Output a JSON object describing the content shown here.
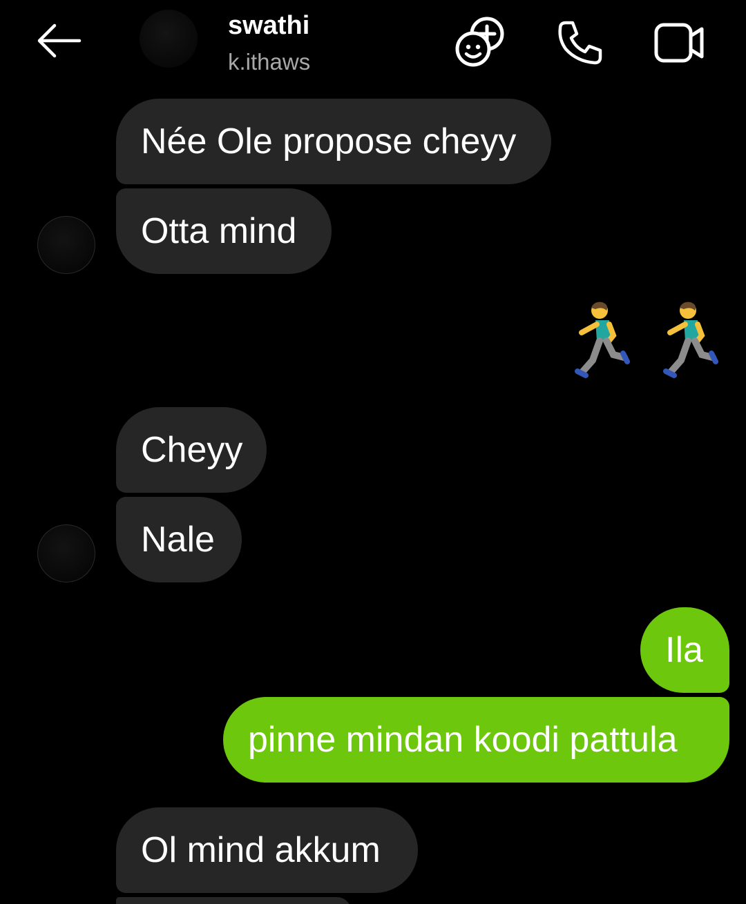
{
  "header": {
    "name": "swathi",
    "username": "k.ithaws",
    "icons": [
      "back-arrow-icon",
      "effects-icon",
      "phone-icon",
      "video-camera-icon"
    ]
  },
  "colors": {
    "background": "#000000",
    "incoming_bubble": "#262626",
    "outgoing_bubble": "#6cc70d",
    "secondary_text": "#a8a8a8"
  },
  "messages": [
    {
      "sender": "them",
      "text": "Née Ole propose cheyy"
    },
    {
      "sender": "them",
      "text": "Otta mind"
    },
    {
      "sender": "me",
      "text": "🏃‍♂️🏃‍♂️",
      "type": "emoji"
    },
    {
      "sender": "them",
      "text": "Cheyy"
    },
    {
      "sender": "them",
      "text": "Nale"
    },
    {
      "sender": "me",
      "text": "Ila"
    },
    {
      "sender": "me",
      "text": "pinne mindan koodi pattula"
    },
    {
      "sender": "them",
      "text": "Ol mind akkum"
    }
  ]
}
